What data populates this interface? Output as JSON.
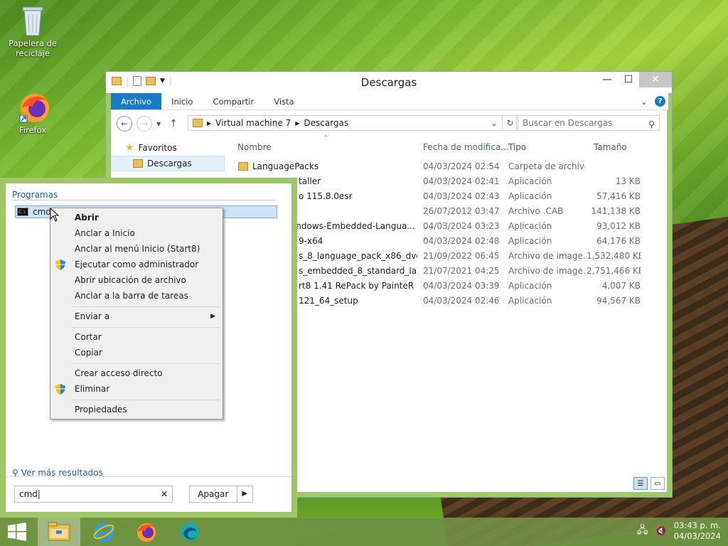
{
  "desktop": {
    "icons": [
      {
        "label": "Papelera de reciclaje",
        "icon": "recycle-bin-icon"
      },
      {
        "label": "Firefox",
        "icon": "firefox-icon"
      }
    ]
  },
  "explorer": {
    "title": "Descargas",
    "ribbon_tabs": [
      "Archivo",
      "Inicio",
      "Compartir",
      "Vista"
    ],
    "address": {
      "segments": [
        "Virtual machine 7",
        "Descargas"
      ]
    },
    "search_placeholder": "Buscar en Descargas",
    "nav": {
      "favorites": "Favoritos",
      "downloads": "Descargas"
    },
    "columns": {
      "name": "Nombre",
      "date": "Fecha de modifica...",
      "type": "Tipo",
      "size": "Tamaño"
    },
    "files": [
      {
        "name": "LanguagePacks",
        "date": "04/03/2024 02:54 ...",
        "type": "Carpeta de archivos",
        "size": ""
      },
      {
        "name": "taller",
        "date": "04/03/2024 02:41 ...",
        "type": "Aplicación",
        "size": "13 KB"
      },
      {
        "name": "o 115.8.0esr",
        "date": "04/03/2024 02:43 ...",
        "type": "Aplicación",
        "size": "57,416 KB"
      },
      {
        "name": "",
        "date": "26/07/2012 03:47 a...",
        "type": "Archivo .CAB",
        "size": "141,138 KB"
      },
      {
        "name": "Vindows-Embedded-Langua...",
        "date": "04/03/2024 03:23 ...",
        "type": "Aplicación",
        "size": "93,012 KB"
      },
      {
        "name": "9-x64",
        "date": "04/03/2024 02:48 ...",
        "type": "Aplicación",
        "size": "64,176 KB"
      },
      {
        "name": "s_8_language_pack_x86_dvd_...",
        "date": "21/09/2022 06:45 a...",
        "type": "Archivo de image...",
        "size": "1,532,480 KB"
      },
      {
        "name": "s_embedded_8_standard_lan...",
        "date": "21/07/2021 04:25 ...",
        "type": "Archivo de image...",
        "size": "2,751,466 KB"
      },
      {
        "name": "rt8 1.41 RePack by PainteR",
        "date": "04/03/2024 03:39 ...",
        "type": "Aplicación",
        "size": "4,007 KB"
      },
      {
        "name": "121_64_setup",
        "date": "04/03/2024 02:46 ...",
        "type": "Aplicación",
        "size": "94,567 KB"
      }
    ]
  },
  "startsearch": {
    "section": "Programas",
    "result": "cmd",
    "more": "Ver más resultados",
    "query": "cmd",
    "shutdown": "Apagar"
  },
  "context_menu": {
    "items": [
      {
        "label": "Abrir",
        "bold": true
      },
      {
        "label": "Anclar a Inicio"
      },
      {
        "label": "Anclar al menú Inicio (Start8)"
      },
      {
        "label": "Ejecutar como administrador",
        "shield": true
      },
      {
        "label": "Abrir ubicación de archivo"
      },
      {
        "label": "Anclar a la barra de tareas"
      },
      {
        "label": "Enviar a",
        "submenu": true
      },
      {
        "label": "Cortar"
      },
      {
        "label": "Copiar"
      },
      {
        "label": "Crear acceso directo"
      },
      {
        "label": "Eliminar",
        "shield": true
      },
      {
        "label": "Propiedades"
      }
    ]
  },
  "taskbar": {
    "apps": [
      "file-explorer-icon",
      "internet-explorer-icon",
      "firefox-icon",
      "edge-icon"
    ],
    "time": "03:43 p. m.",
    "date": "04/03/2024"
  }
}
